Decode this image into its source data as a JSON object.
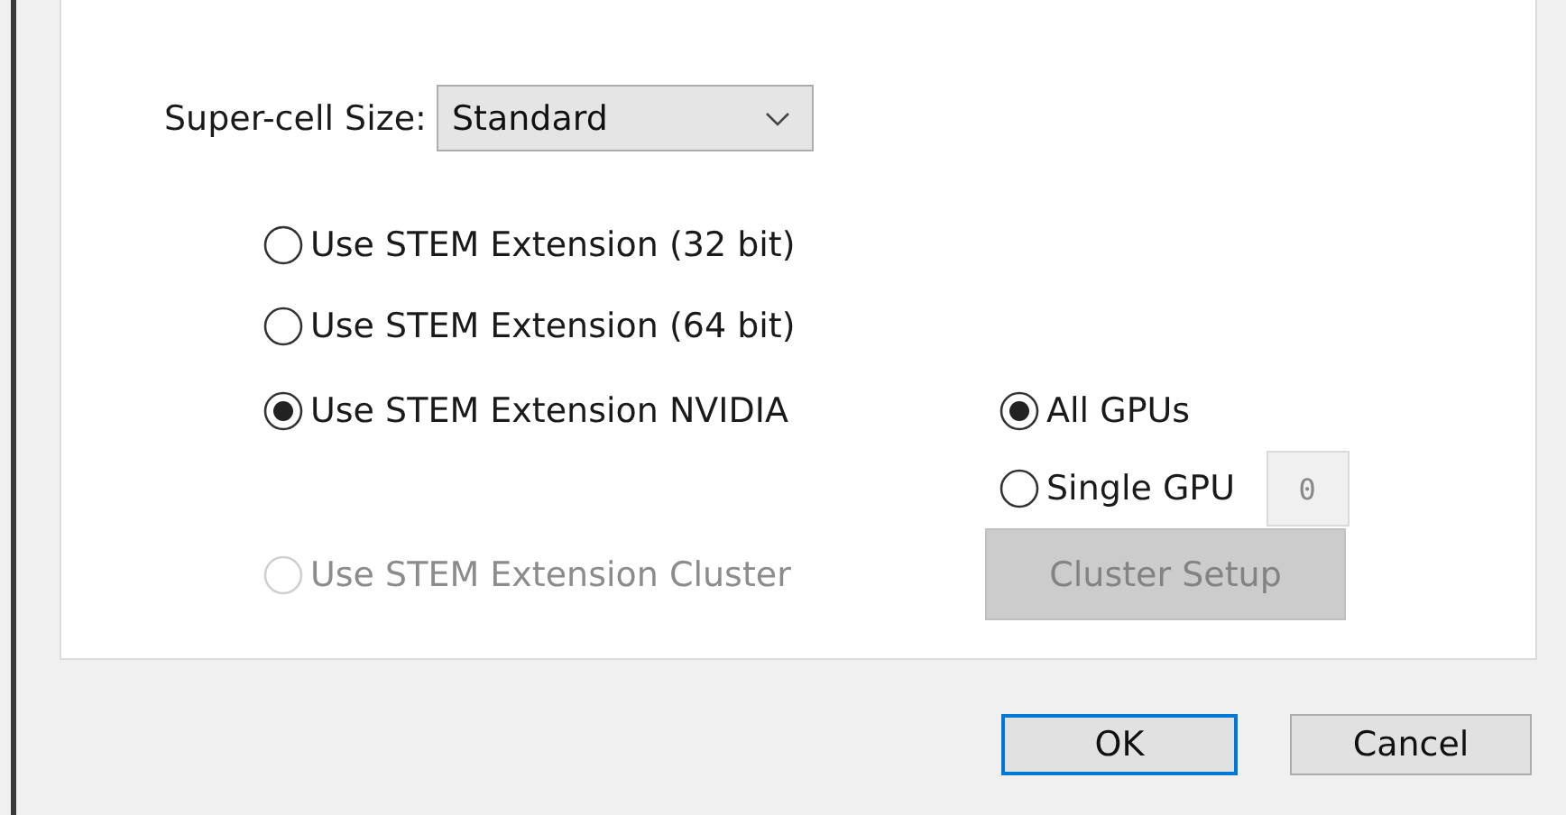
{
  "super_cell_size": {
    "label": "Super-cell Size:",
    "value": "Standard"
  },
  "modes": [
    {
      "label": "Use STEM Extension (32 bit)",
      "selected": false,
      "disabled": false
    },
    {
      "label": "Use STEM Extension (64 bit)",
      "selected": false,
      "disabled": false
    },
    {
      "label": "Use STEM Extension NVIDIA",
      "selected": true,
      "disabled": false
    },
    {
      "label": "Use STEM Extension Cluster",
      "selected": false,
      "disabled": true
    }
  ],
  "gpu_options": [
    {
      "label": "All GPUs",
      "selected": true
    },
    {
      "label": "Single GPU",
      "selected": false
    }
  ],
  "gpu_index": {
    "value": "0",
    "disabled": true
  },
  "cluster_setup_button": {
    "label": "Cluster Setup",
    "disabled": true
  },
  "buttons": [
    {
      "label": "OK",
      "default": true
    },
    {
      "label": "Cancel",
      "default": false
    }
  ]
}
